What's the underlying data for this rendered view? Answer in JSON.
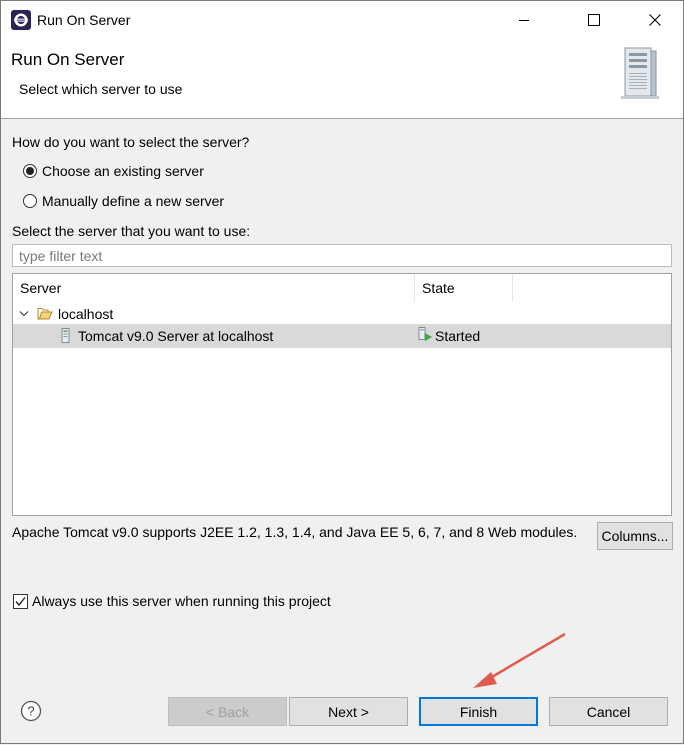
{
  "window": {
    "title": "Run On Server"
  },
  "banner": {
    "title": "Run On Server",
    "subtitle": "Select which server to use"
  },
  "selection": {
    "question": "How do you want to select the server?",
    "option_existing": "Choose an existing server",
    "option_manual": "Manually define a new server",
    "selected": "existing"
  },
  "server_list": {
    "label": "Select the server that you want to use:",
    "filter_placeholder": "type filter text",
    "columns": [
      "Server",
      "State"
    ],
    "group": "localhost",
    "rows": [
      {
        "name": "Tomcat v9.0 Server at localhost",
        "state": "Started",
        "selected": true
      }
    ]
  },
  "info_text": "Apache Tomcat v9.0 supports J2EE 1.2, 1.3, 1.4, and Java EE 5, 6, 7, and 8 Web modules.",
  "columns_button": "Columns...",
  "always_use": {
    "label": "Always use this server when running this project",
    "checked": true
  },
  "buttons": {
    "back": "< Back",
    "next": "Next >",
    "finish": "Finish",
    "cancel": "Cancel"
  },
  "colors": {
    "accent": "#0078d7",
    "annotation_arrow": "#e05a4e",
    "selected_row": "#d9d9d9"
  }
}
